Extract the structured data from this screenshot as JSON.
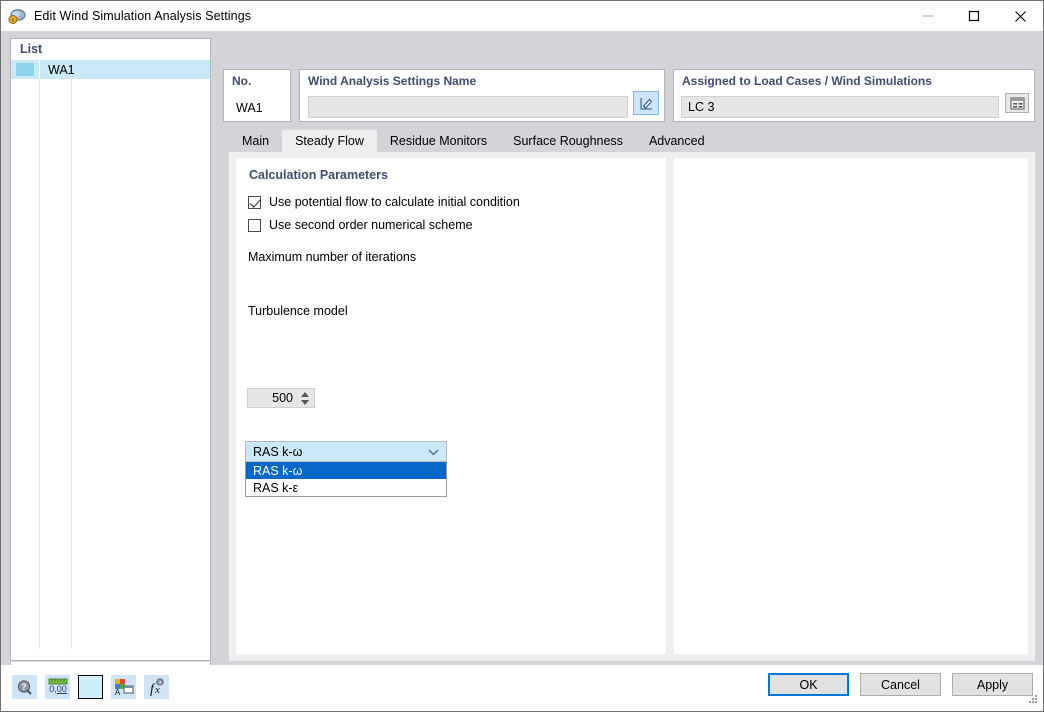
{
  "window": {
    "title": "Edit Wind Simulation Analysis Settings",
    "app_icon": "wind-simulation-icon",
    "controls": {
      "minimize": "minimize-icon",
      "maximize": "maximize-icon",
      "close": "close-icon"
    }
  },
  "list_panel": {
    "header": "List",
    "rows": [
      {
        "label": "WA1",
        "color": "#8ed4ef",
        "selected": true
      }
    ],
    "toolbar": {
      "new_label": "new-item-icon",
      "copy_label": "duplicate-item-icon",
      "check_label": "check-all-icon",
      "uncheck_label": "toggle-check-icon",
      "delete_label": "delete-icon"
    }
  },
  "header": {
    "no": {
      "title": "No.",
      "value": "WA1"
    },
    "name": {
      "title": "Wind Analysis Settings Name",
      "value": "",
      "placeholder": "",
      "edit_icon": "pencil-edit-icon"
    },
    "assigned": {
      "title": "Assigned to Load Cases / Wind Simulations",
      "value": "LC 3",
      "button_icon": "table-select-icon"
    }
  },
  "tabs": [
    {
      "label": "Main",
      "selected": false
    },
    {
      "label": "Steady Flow",
      "selected": true
    },
    {
      "label": "Residue Monitors",
      "selected": false
    },
    {
      "label": "Surface Roughness",
      "selected": false
    },
    {
      "label": "Advanced",
      "selected": false
    }
  ],
  "steady_flow": {
    "section_title": "Calculation Parameters",
    "checkboxes": [
      {
        "label": "Use potential flow to calculate initial condition",
        "checked": true
      },
      {
        "label": "Use second order numerical scheme",
        "checked": false
      }
    ],
    "iterations": {
      "label": "Maximum number of iterations",
      "value": "500"
    },
    "turbulence": {
      "label": "Turbulence model",
      "selected": "RAS k-ω",
      "expanded": true,
      "options": [
        {
          "label": "RAS k-ω",
          "highlighted": true
        },
        {
          "label": "RAS k-ε",
          "highlighted": false
        }
      ]
    }
  },
  "status_icons": [
    {
      "name": "help-icon"
    },
    {
      "name": "units-icon"
    },
    {
      "name": "color-swatch-icon"
    },
    {
      "name": "display-properties-icon"
    },
    {
      "name": "formula-icon"
    }
  ],
  "dialog_buttons": {
    "ok": "OK",
    "cancel": "Cancel",
    "apply": "Apply"
  },
  "colors": {
    "accent": "#0568c8",
    "selection": "#cbe8f8",
    "group_title": "#3f4c6b",
    "default_button_border": "#0078d7",
    "delete_red": "#e01b24"
  }
}
